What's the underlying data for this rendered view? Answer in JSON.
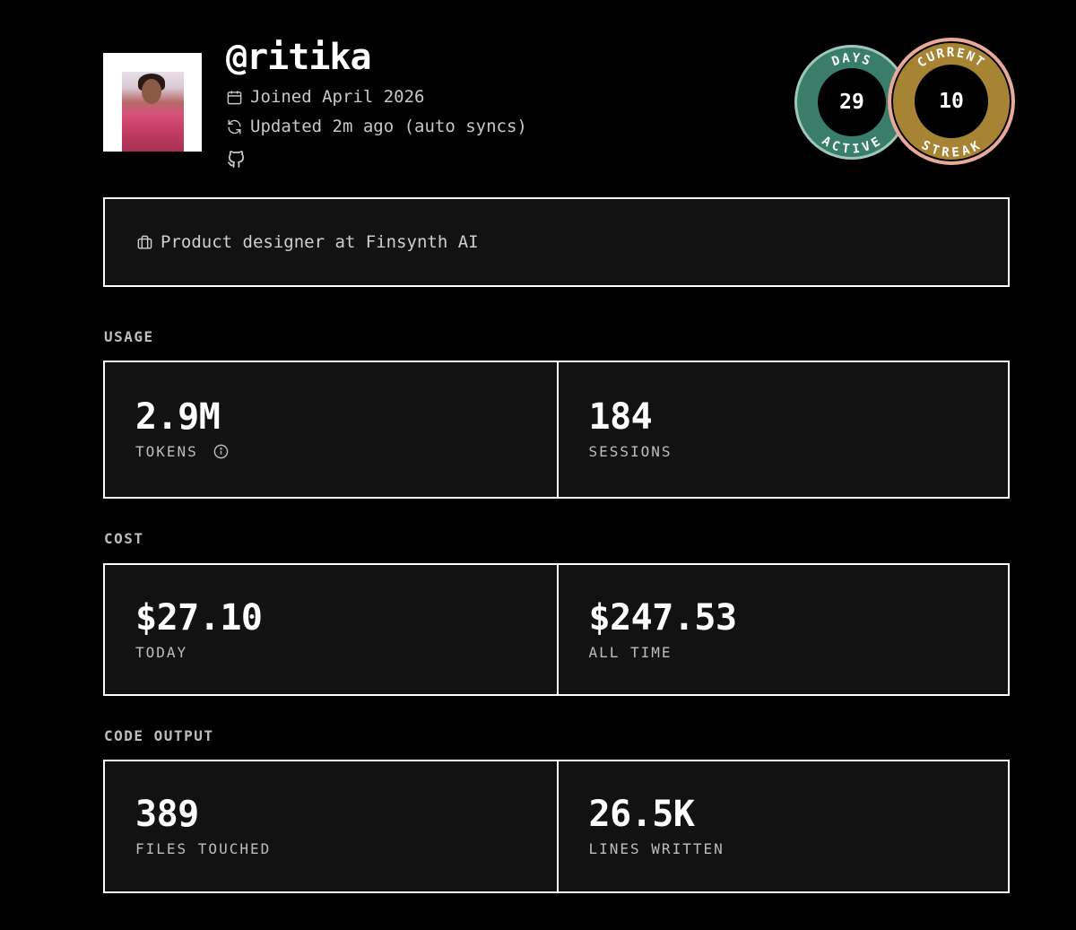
{
  "profile": {
    "username": "@ritika",
    "joined": "Joined April 2026",
    "updated": "Updated 2m ago (auto syncs)"
  },
  "badges": {
    "days_active": {
      "top_text": "DAYS",
      "bottom_text": "ACTIVE",
      "value": "29",
      "color": "#3a7d6a"
    },
    "current_streak": {
      "top_text": "CURRENT",
      "bottom_text": "STREAK",
      "value": "10",
      "color": "#a78434"
    }
  },
  "bio": {
    "text": "Product designer at Finsynth AI"
  },
  "sections": {
    "usage": {
      "label": "USAGE",
      "tokens": {
        "value": "2.9M",
        "label": "TOKENS"
      },
      "sessions": {
        "value": "184",
        "label": "SESSIONS"
      }
    },
    "cost": {
      "label": "COST",
      "today": {
        "value": "$27.10",
        "label": "TODAY"
      },
      "all_time": {
        "value": "$247.53",
        "label": "ALL TIME"
      }
    },
    "code_output": {
      "label": "CODE OUTPUT",
      "files": {
        "value": "389",
        "label": "FILES TOUCHED"
      },
      "lines": {
        "value": "26.5K",
        "label": "LINES WRITTEN"
      }
    }
  }
}
